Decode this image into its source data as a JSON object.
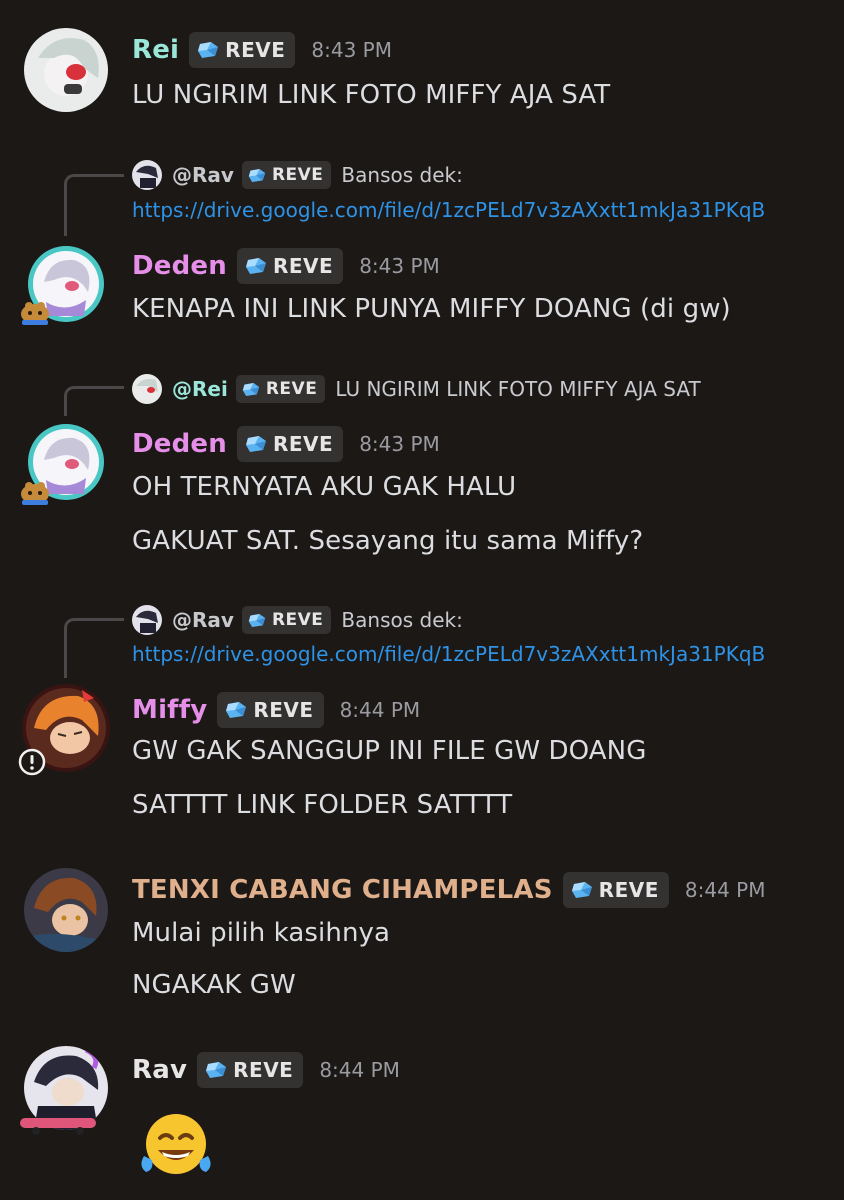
{
  "messages": [
    {
      "author": "Rei",
      "name_color": "#9ae6d8",
      "tag": "REVE",
      "time": "8:43 PM",
      "lines": [
        "LU NGIRIM LINK FOTO MIFFY AJA SAT"
      ]
    },
    {
      "reply": {
        "author": "@Rav",
        "tag": "REVE",
        "text": "Bansos dek:",
        "link": "https://drive.google.com/file/d/1zcPELd7v3zAXxtt1mkJa31PKqB"
      },
      "author": "Deden",
      "name_color": "#e58fe8",
      "tag": "REVE",
      "time": "8:43 PM",
      "lines": [
        "KENAPA INI LINK PUNYA MIFFY DOANG (di gw)"
      ]
    },
    {
      "reply": {
        "author": "@Rei",
        "tag": "REVE",
        "text": "LU NGIRIM LINK FOTO MIFFY AJA SAT"
      },
      "author": "Deden",
      "name_color": "#e58fe8",
      "tag": "REVE",
      "time": "8:43 PM",
      "lines": [
        "OH TERNYATA AKU GAK HALU",
        "GAKUAT SAT. Sesayang itu sama Miffy?"
      ]
    },
    {
      "reply": {
        "author": "@Rav",
        "tag": "REVE",
        "text": "Bansos dek:",
        "link": "https://drive.google.com/file/d/1zcPELd7v3zAXxtt1mkJa31PKqB"
      },
      "author": "Miffy",
      "name_color": "#e58fe8",
      "tag": "REVE",
      "time": "8:44 PM",
      "lines": [
        "GW GAK SANGGUP INI FILE GW DOANG",
        "SATTTT LINK FOLDER SATTTT"
      ]
    },
    {
      "author": "TENXI CABANG CIHAMPELAS",
      "name_color": "#e0b08d",
      "tag": "REVE",
      "time": "8:44 PM",
      "lines": [
        "Mulai pilih kasihnya",
        "NGAKAK GW"
      ]
    },
    {
      "author": "Rav",
      "name_color": "#e6e6e6",
      "tag": "REVE",
      "time": "8:44 PM",
      "emoji": "joy-emoji"
    }
  ],
  "colors": {
    "background": "#1b1816",
    "link": "#2e93e6",
    "tag_bg": "#343131",
    "gem": "#5ab2f0"
  }
}
